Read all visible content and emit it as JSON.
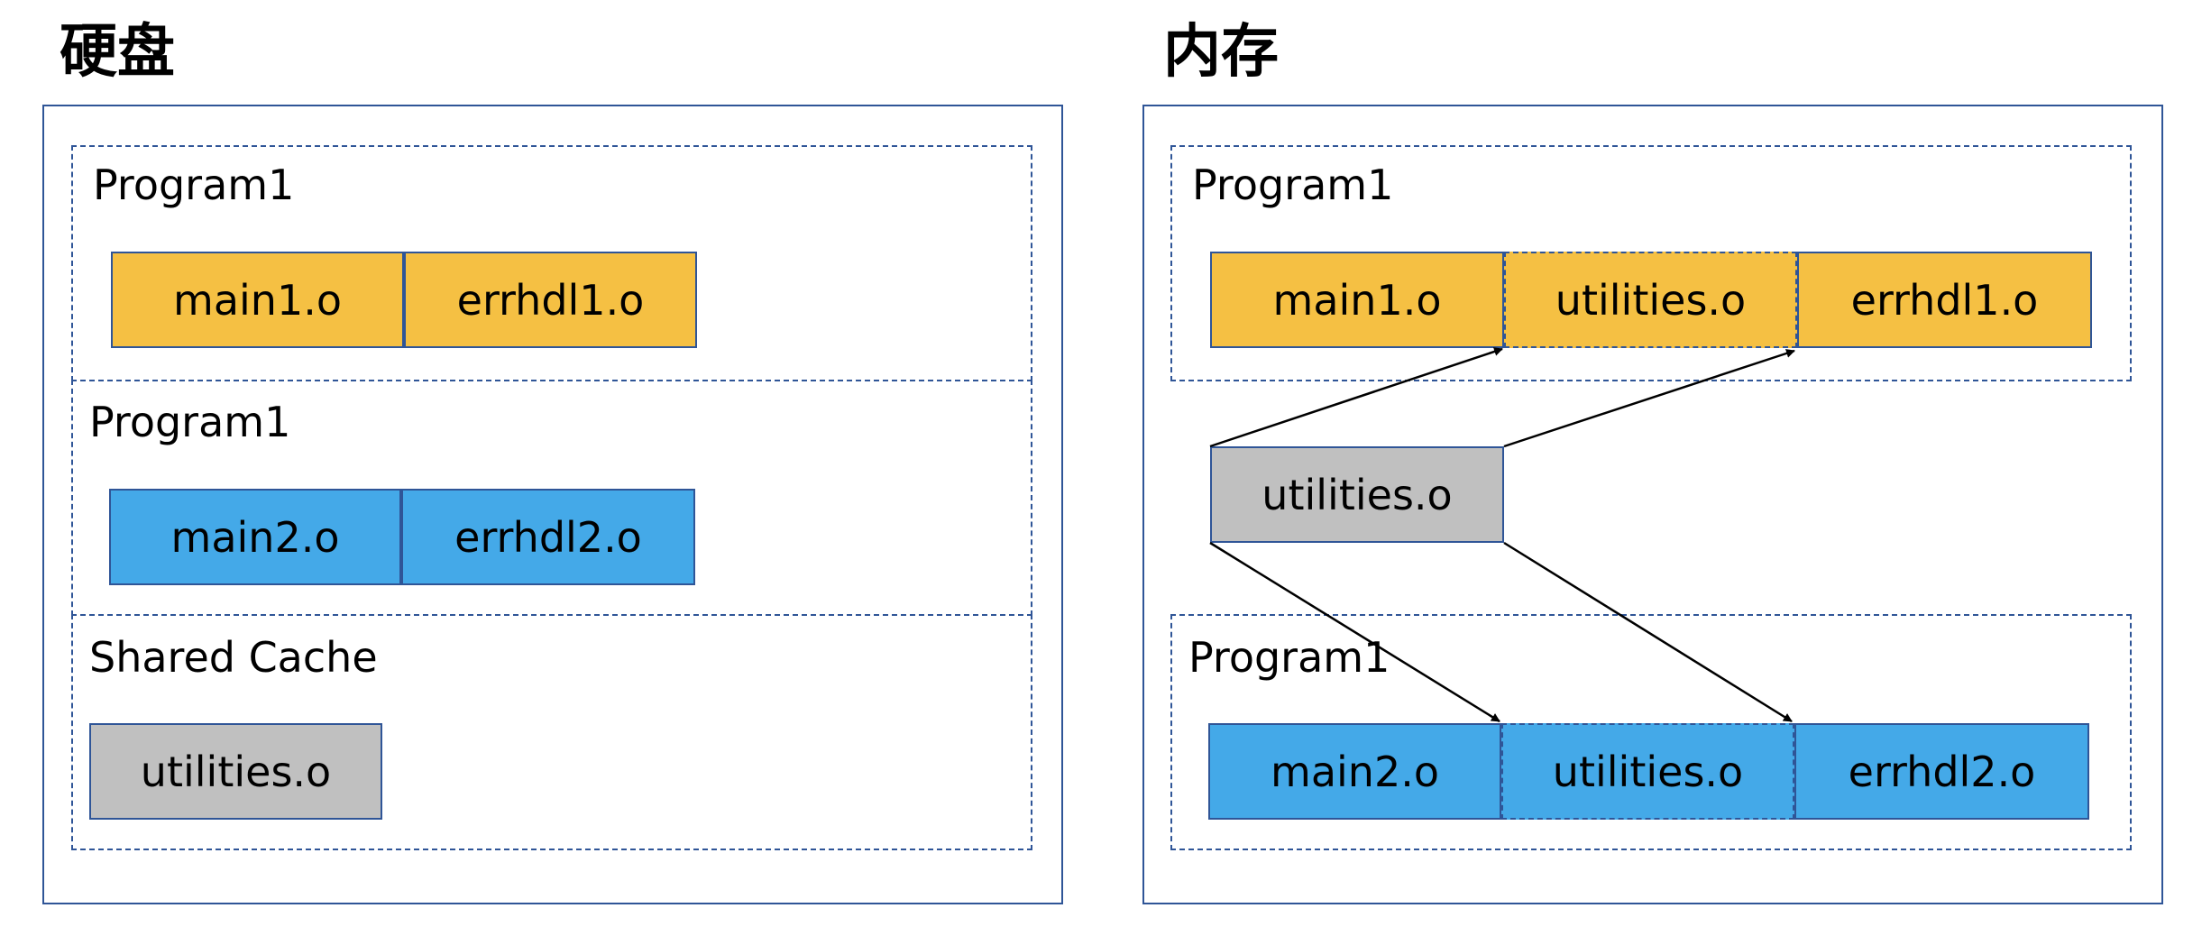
{
  "left": {
    "title": "硬盘",
    "groups": [
      {
        "label": "Program1",
        "boxes": [
          "main1.o",
          "errhdl1.o"
        ]
      },
      {
        "label": "Program1",
        "boxes": [
          "main2.o",
          "errhdl2.o"
        ]
      },
      {
        "label": "Shared Cache",
        "boxes": [
          "utilities.o"
        ]
      }
    ]
  },
  "right": {
    "title": "内存",
    "top_group": {
      "label": "Program1",
      "boxes": [
        "main1.o",
        "utilities.o",
        "errhdl1.o"
      ]
    },
    "shared_box": "utilities.o",
    "bottom_group": {
      "label": "Program1",
      "boxes": [
        "main2.o",
        "utilities.o",
        "errhdl2.o"
      ]
    }
  },
  "colors": {
    "program1": "#f5c043",
    "program2": "#44a9e8",
    "shared": "#c0c0c0",
    "border": "#2f5597"
  }
}
